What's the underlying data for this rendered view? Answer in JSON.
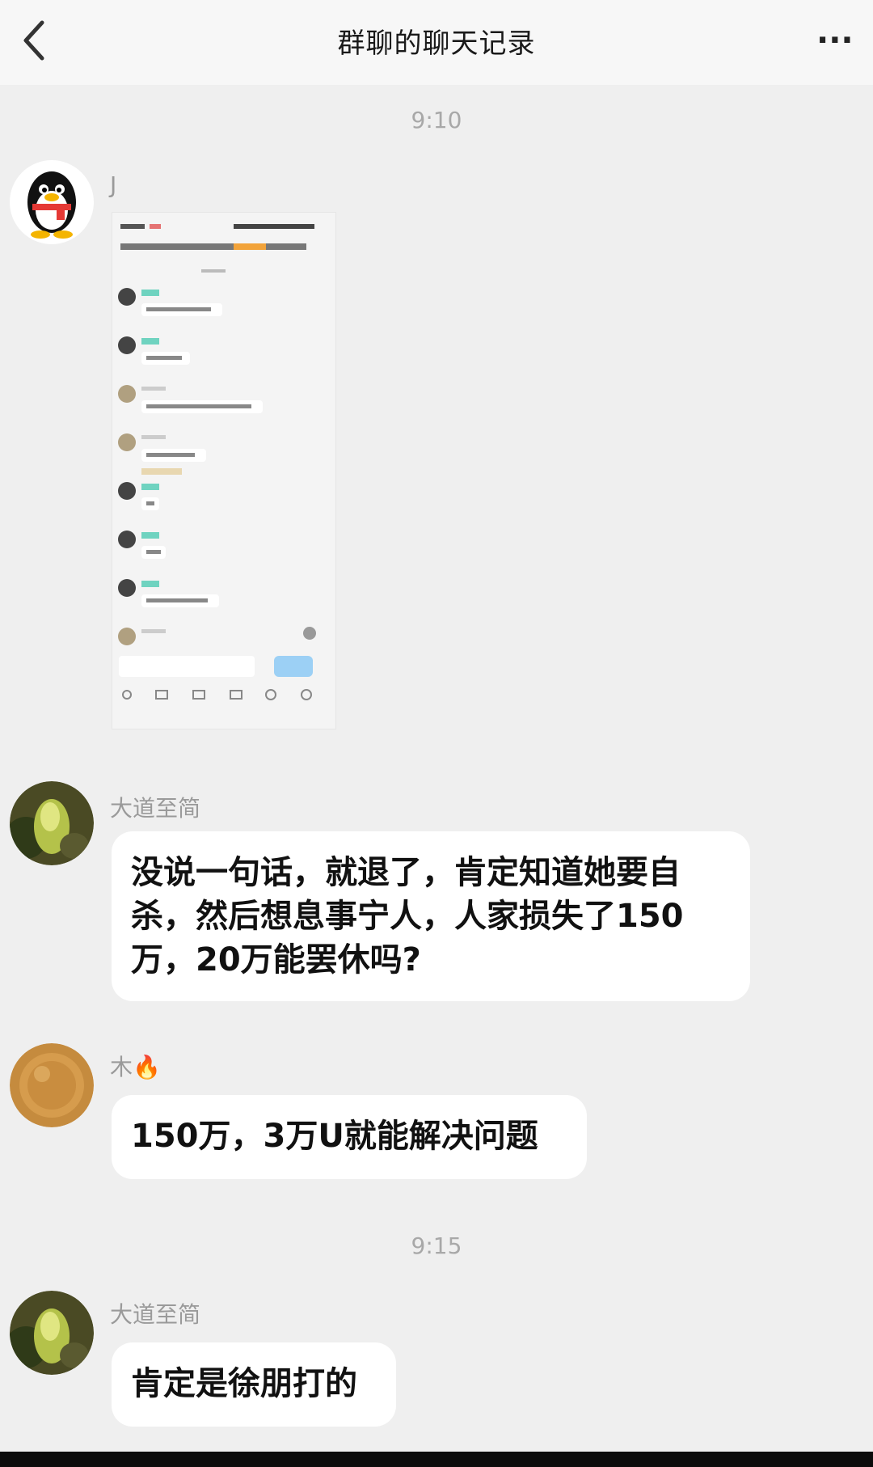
{
  "header": {
    "title": "群聊的聊天记录",
    "more_label": "···"
  },
  "messages": [
    {
      "type": "time",
      "text": "9:10"
    },
    {
      "type": "image",
      "sender": "J",
      "image_desc": "chat-screenshot"
    },
    {
      "type": "text",
      "sender": "大道至简",
      "text": "没说一句话，就退了，肯定知道她要自杀，然后想息事宁人，人家损失了150万，20万能罢休吗?"
    },
    {
      "type": "text",
      "sender": "木🔥",
      "text": "150万，3万U就能解决问题"
    },
    {
      "type": "time",
      "text": "9:15"
    },
    {
      "type": "text",
      "sender": "大道至简",
      "text": "肯定是徐朋打的"
    }
  ],
  "colors": {
    "background": "#efefef",
    "bubble": "#ffffff",
    "meta": "#9a9a9a",
    "accent": "#5ac8a8"
  },
  "icons": [
    "chevron-left-icon",
    "more-icon",
    "qq-penguin-avatar",
    "plant-avatar",
    "coin-avatar"
  ]
}
